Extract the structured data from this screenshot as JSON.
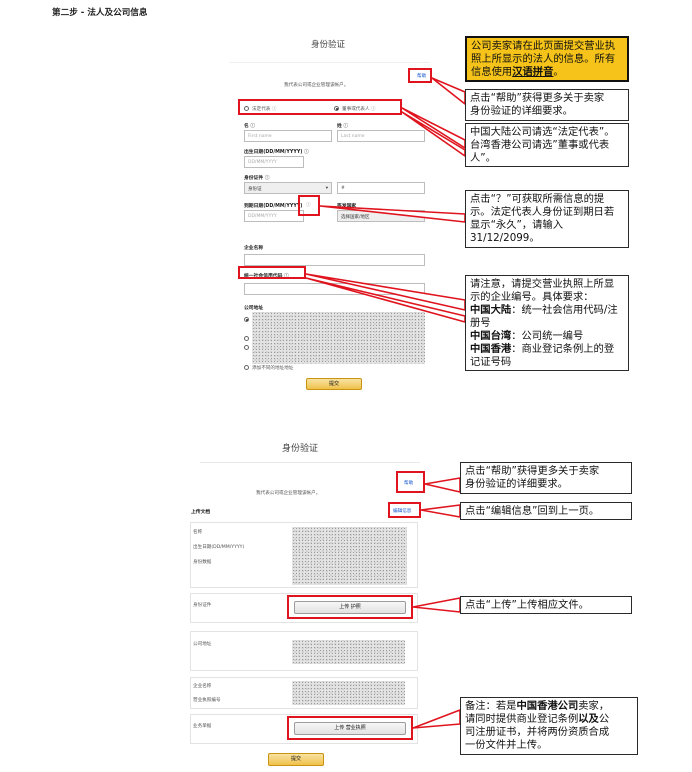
{
  "step_title": "第二步 - 法人及公司信息",
  "form1": {
    "title": "身份验证",
    "subtitle": "我代表公司或企业管理该帐户。",
    "help_link": "帮助",
    "radio_legal_rep": "法定代表",
    "radio_director": "董事或代表人",
    "first_name_label": "名",
    "first_name_placeholder": "First name",
    "last_name_label": "姓",
    "last_name_placeholder": "Last name",
    "dob_label": "出生日期(DD/MM/YYYY)",
    "dob_placeholder": "DD/MM/YYYY",
    "id_doc_label": "身份证件",
    "id_doc_value": "身份证",
    "id_number_value": "#",
    "expiry_label": "到期日期(DD/MM/YYYY)",
    "expiry_placeholder": "DD/MM/YYYY",
    "issuing_country_label": "签发国家",
    "issuing_country_value": "选择国家/地区",
    "company_name_label": "企业名称",
    "credit_code_label": "统一社会信用代码",
    "company_address_label": "公司地址",
    "add_address_label": "添加不同的地址地址",
    "submit_label": "提交"
  },
  "form2": {
    "title": "身份验证",
    "subtitle": "我代表公司或企业管理该帐户。",
    "help_link": "帮助",
    "upload_docs_label": "上传文档",
    "edit_info_link": "编辑信息",
    "name_label": "名称",
    "dob_label": "出生日期(DD/MM/YYYY)",
    "id_data_label": "身份数据",
    "id_doc_label": "身份证件",
    "upload_passport_label": "上传 护照",
    "company_address_label": "公司地址",
    "company_name_label": "企业名称",
    "license_number_label": "营业执照编号",
    "business_doc_label": "业务单据",
    "upload_license_label": "上传 营业执照",
    "submit_label": "提交"
  },
  "callouts": {
    "c1_line1": "公司卖家请在此页面提交营业执",
    "c1_line2": "照上所显示的法人的信息。所有",
    "c1_line3_pre": "信息使用",
    "c1_line3_bold": "汉语拼音",
    "c1_line3_post": "。",
    "c2_line1": "点击“帮助”获得更多关于卖家",
    "c2_line2": "身份验证的详细要求。",
    "c3_line1": "中国大陆公司请选“法定代表”。",
    "c3_line2": "台湾香港公司请选”董事或代表",
    "c3_line3": "人”。",
    "c4_line1": "点击“？”可获取所需信息的提",
    "c4_line2": "示。法定代表人身份证到期日若",
    "c4_line3": "显示“永久”，请输入",
    "c4_line4": "31/12/2099。",
    "c5_line1": "请注意，请提交营业执照上所显",
    "c5_line2": "示的企业编号。具体要求：",
    "c5_line3_bold": "中国大陆",
    "c5_line3_rest": "：统一社会信用代码/注",
    "c5_line4": "册号",
    "c5_line5_bold": "中国台湾",
    "c5_line5_rest": "：公司统一编号",
    "c5_line6_bold": "中国香港",
    "c5_line6_rest": "：商业登记条例上的登",
    "c5_line7": "记证号码",
    "c6_line1": "点击“帮助”获得更多关于卖家",
    "c6_line2": "身份验证的详细要求。",
    "c7": "点击“编辑信息”回到上一页。",
    "c8": "点击“上传”上传相应文件。",
    "c9_line1_pre": "备注：若是",
    "c9_line1_bold": "中国香港公司",
    "c9_line1_post": "卖家，",
    "c9_line2_pre": "请同时提供商业登记条例",
    "c9_line2_bold": "以及",
    "c9_line2_post": "公",
    "c9_line3": "司注册证书，并将两份资质合成",
    "c9_line4": "一份文件并上传。"
  },
  "colors": {
    "highlight_red": "#e0141e",
    "note_yellow": "#f5c319",
    "button_yellow": "#f0c14b"
  }
}
